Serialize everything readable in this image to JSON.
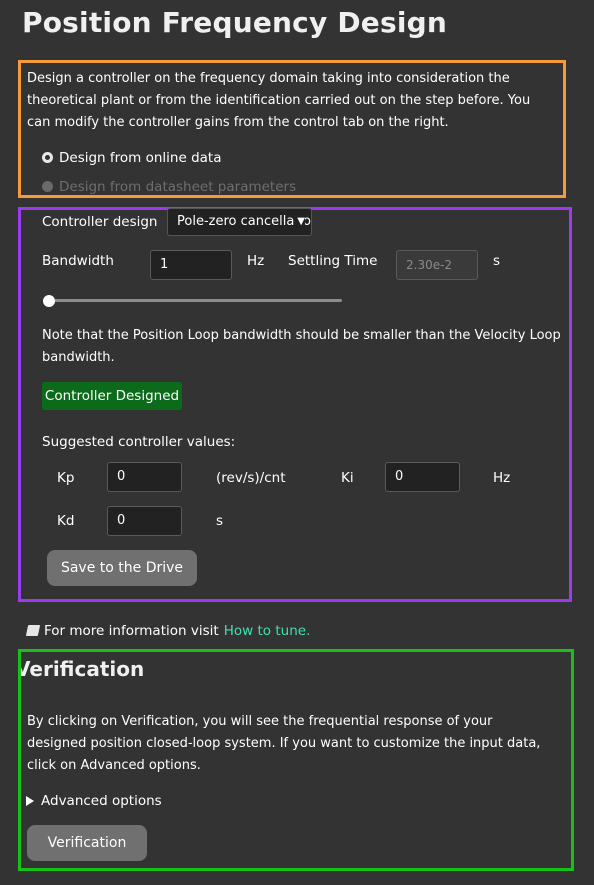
{
  "page": {
    "title": "Position Frequency Design"
  },
  "design_source": {
    "description": "Design a controller on the frequency domain taking into consideration the theoretical plant or from the identification carried out on the step before. You can modify the controller gains from the control tab on the right.",
    "options": [
      {
        "label": "Design from online data",
        "selected": true,
        "enabled": true
      },
      {
        "label": "Design from datasheet parameters",
        "selected": false,
        "enabled": false
      }
    ]
  },
  "controller": {
    "design_label": "Controller design",
    "design_value": "Pole-zero cancellation",
    "bandwidth_label": "Bandwidth",
    "bandwidth_value": "1",
    "bandwidth_unit": "Hz",
    "settling_label": "Settling Time",
    "settling_value": "2.30e-2",
    "settling_unit": "s",
    "slider_level": 0.0,
    "note": "Note that the Position Loop bandwidth should be smaller than the Velocity Loop bandwidth.",
    "status_badge": "Controller Designed",
    "suggested_label": "Suggested controller values:",
    "kp_label": "Kp",
    "kp_value": "0",
    "kp_unit": "(rev/s)/cnt",
    "ki_label": "Ki",
    "ki_value": "0",
    "ki_unit": "Hz",
    "kd_label": "Kd",
    "kd_value": "0",
    "kd_unit": "s",
    "save_button": "Save to the Drive"
  },
  "info": {
    "icon": "book-icon",
    "text": "For more information visit",
    "link": "How to tune."
  },
  "verification": {
    "title": "Verification",
    "description": "By clicking on Verification, you will see the frequential response of your designed position closed-loop system. If you want to customize the input data, click on Advanced options.",
    "advanced_label": "Advanced options",
    "button": "Verification"
  },
  "colors": {
    "orange_box": "#f59a3b",
    "purple_box": "#9b3cf0",
    "green_box": "#17c117",
    "badge_green": "#0c6b1a",
    "link": "#3ee0b0"
  }
}
